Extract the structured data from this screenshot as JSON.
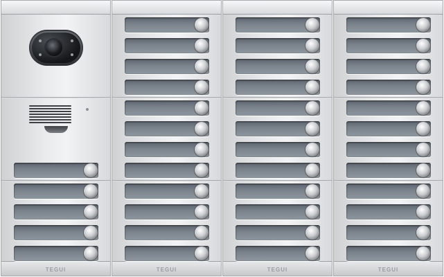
{
  "brand": {
    "logo_text": "TEGUI"
  },
  "colors": {
    "frame": "#e3e4e5",
    "nameplate": "#707982",
    "button": "#c9cbce"
  },
  "icons": {
    "camera": "camera-lens-icon",
    "speaker": "speaker-grille-icon",
    "push_button": "round-push-button-icon"
  },
  "panel": {
    "columns": [
      {
        "modules": [
          {
            "kind": "camera"
          },
          {
            "kind": "audio",
            "buttons": 1
          },
          {
            "kind": "buttons",
            "buttons": 4
          }
        ]
      },
      {
        "modules": [
          {
            "kind": "buttons",
            "buttons": 4
          },
          {
            "kind": "buttons",
            "buttons": 4
          },
          {
            "kind": "buttons",
            "buttons": 4
          }
        ]
      },
      {
        "modules": [
          {
            "kind": "buttons",
            "buttons": 4
          },
          {
            "kind": "buttons",
            "buttons": 4
          },
          {
            "kind": "buttons",
            "buttons": 4
          }
        ]
      },
      {
        "modules": [
          {
            "kind": "buttons",
            "buttons": 4
          },
          {
            "kind": "buttons",
            "buttons": 4
          },
          {
            "kind": "buttons",
            "buttons": 4
          }
        ]
      }
    ]
  }
}
